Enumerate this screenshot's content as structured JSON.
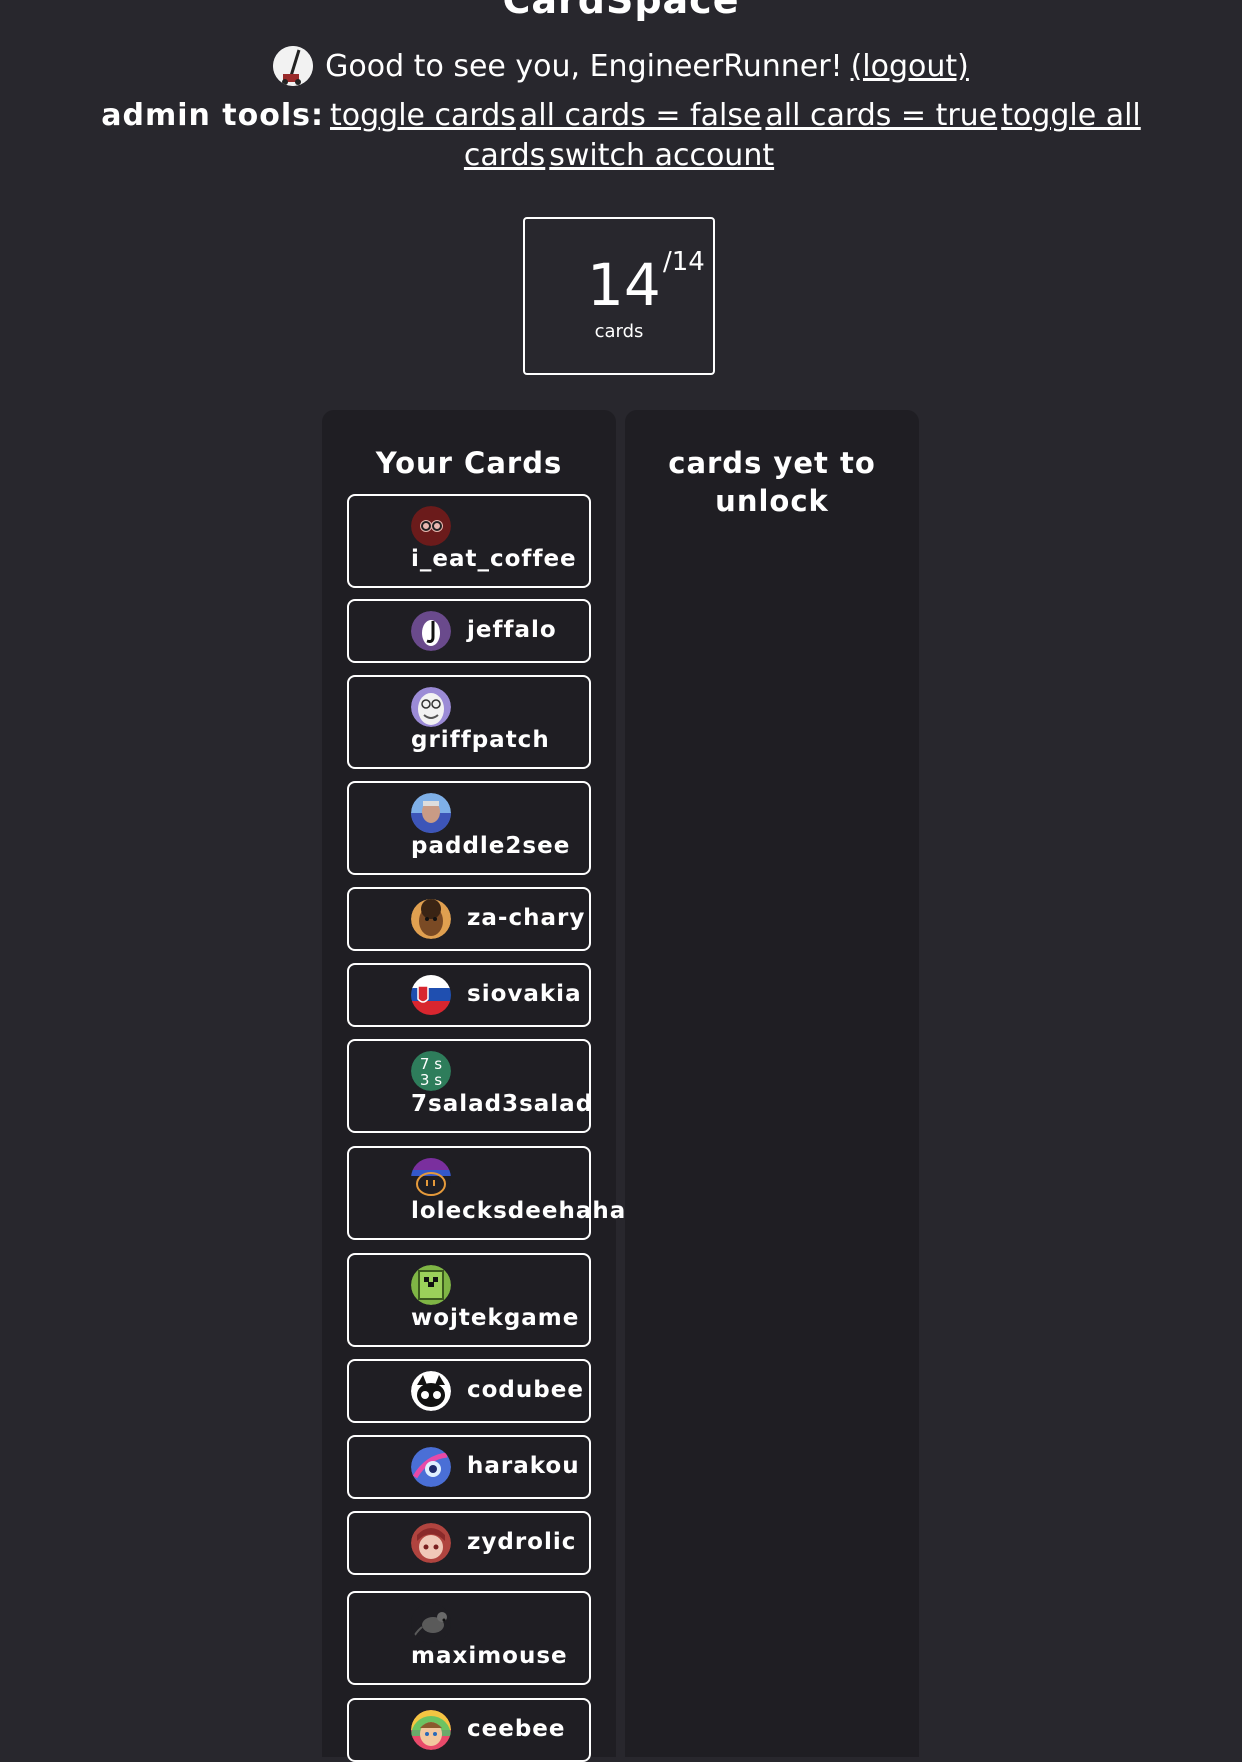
{
  "site_title": "CardSpace",
  "greeting": {
    "text": "Good to see you, EngineerRunner!",
    "logout": "(logout)"
  },
  "admin": {
    "label": "admin tools:",
    "links": [
      "toggle cards",
      "all cards = false",
      "all cards = true",
      "toggle all cards",
      "switch account"
    ]
  },
  "counter": {
    "count": "14",
    "total": "/14",
    "unit": "cards"
  },
  "panels": {
    "yours": "Your Cards",
    "locked": "cards yet to unlock"
  },
  "cards": [
    {
      "name": "i_eat_coffee",
      "color": "#7a1f1f"
    },
    {
      "name": "jeffalo",
      "color": "#6a4a8c"
    },
    {
      "name": "griffpatch",
      "color": "#9b8bd6"
    },
    {
      "name": "paddle2see",
      "color": "#5b74c9"
    },
    {
      "name": "za-chary",
      "color": "#8a5a2e"
    },
    {
      "name": "siovakia",
      "color": "#1f4fb0"
    },
    {
      "name": "7salad3salad",
      "color": "#2e7d5b"
    },
    {
      "name": "lolecksdeehaha",
      "color": "#3a2a6b"
    },
    {
      "name": "wojtekgame",
      "color": "#7fb545"
    },
    {
      "name": "codubee",
      "color": "#ffffff"
    },
    {
      "name": "harakou",
      "color": "#4a6fd6"
    },
    {
      "name": "zydrolic",
      "color": "#b0443f"
    },
    {
      "name": "maximouse",
      "color": "#3a3a3a"
    },
    {
      "name": "ceebee",
      "color": "#d2a36a"
    }
  ]
}
